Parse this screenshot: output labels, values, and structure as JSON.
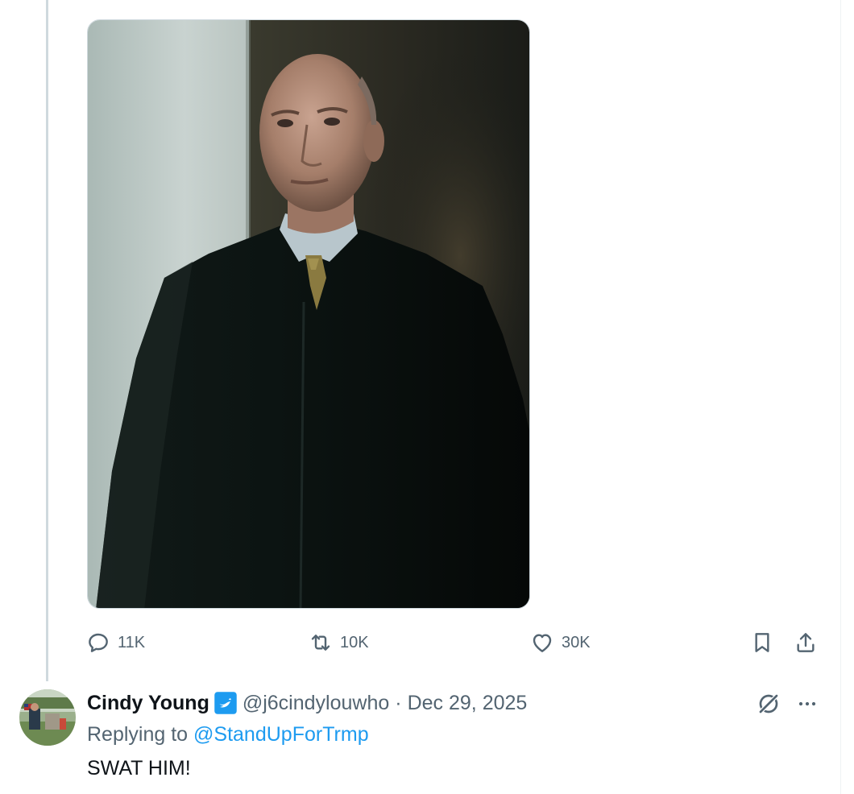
{
  "tweet": {
    "media": {
      "alt": ""
    },
    "actions": {
      "reply_count": "11K",
      "retweet_count": "10K",
      "like_count": "30K"
    }
  },
  "reply": {
    "display_name": "Cindy Young",
    "handle": "@j6cindylouwho",
    "separator": "·",
    "date": "Dec 29, 2025",
    "replying_prefix": "Replying to",
    "replying_to": "@StandUpForTrmp",
    "text": "SWAT HIM!"
  },
  "colors": {
    "secondary_text": "#536471",
    "primary_text": "#0f1419",
    "accent": "#1d9bf0",
    "thread_line": "#cfd9de"
  },
  "icons": {
    "reply": "speech-bubble-icon",
    "retweet": "retweet-icon",
    "like": "heart-icon",
    "bookmark": "bookmark-icon",
    "share": "share-icon",
    "verified": "verified-badge-icon",
    "grok": "grok-icon",
    "more": "more-dots-icon"
  }
}
